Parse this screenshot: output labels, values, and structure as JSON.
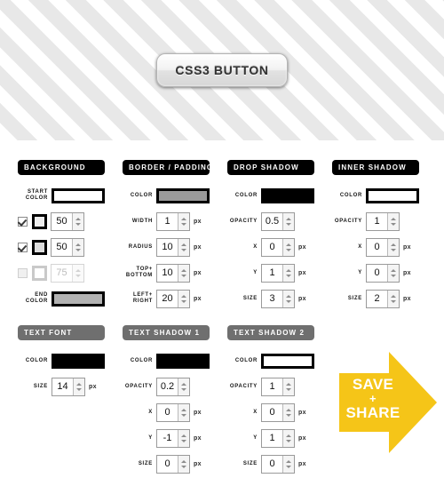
{
  "preview": {
    "button_label": "CSS3 BUTTON",
    "background_pattern": "diagonal-stripes",
    "stripe_color": "#e8e8e8",
    "base_color": "#ffffff"
  },
  "panels": {
    "background": {
      "title": "BACKGROUND",
      "header_color": "#000000",
      "start_color": {
        "label": "START COLOR",
        "value": "#ffffff"
      },
      "stops": [
        {
          "checked": true,
          "enabled": true,
          "swatch": "#eeeeee",
          "value": "50"
        },
        {
          "checked": true,
          "enabled": true,
          "swatch": "#dddddd",
          "value": "50"
        },
        {
          "checked": false,
          "enabled": false,
          "swatch": "#ffffff",
          "value": "75"
        }
      ],
      "end_color": {
        "label": "END COLOR",
        "value": "#b2b2b2"
      }
    },
    "border_padding": {
      "title": "BORDER / PADDING",
      "header_color": "#000000",
      "color": {
        "label": "COLOR",
        "value": "#9a9a9a"
      },
      "fields": [
        {
          "label": "WIDTH",
          "value": "1",
          "unit": "px"
        },
        {
          "label": "RADIUS",
          "value": "10",
          "unit": "px"
        },
        {
          "label": "TOP + BOTTOM",
          "label_line1": "TOP+",
          "label_line2": "BOTTOM",
          "value": "10",
          "unit": "px"
        },
        {
          "label": "LEFT + RIGHT",
          "label_line1": "LEFT+",
          "label_line2": "RIGHT",
          "value": "20",
          "unit": "px"
        }
      ]
    },
    "drop_shadow": {
      "title": "DROP SHADOW",
      "header_color": "#000000",
      "color": {
        "label": "COLOR",
        "value": "#000000"
      },
      "fields": [
        {
          "label": "OPACITY",
          "value": "0.5",
          "unit": ""
        },
        {
          "label": "x",
          "value": "0",
          "unit": "px"
        },
        {
          "label": "y",
          "value": "1",
          "unit": "px"
        },
        {
          "label": "SIZE",
          "value": "3",
          "unit": "px"
        }
      ]
    },
    "inner_shadow": {
      "title": "INNER SHADOW",
      "header_color": "#000000",
      "color": {
        "label": "COLOR",
        "value": "#ffffff"
      },
      "fields": [
        {
          "label": "OPACITY",
          "value": "1",
          "unit": ""
        },
        {
          "label": "x",
          "value": "0",
          "unit": "px"
        },
        {
          "label": "y",
          "value": "0",
          "unit": "px"
        },
        {
          "label": "SIZE",
          "value": "2",
          "unit": "px"
        }
      ]
    },
    "text_font": {
      "title": "TEXT FONT",
      "header_color": "#6f6f6f",
      "color": {
        "label": "COLOR",
        "value": "#000000"
      },
      "fields": [
        {
          "label": "SIZE",
          "value": "14",
          "unit": "px"
        }
      ]
    },
    "text_shadow_1": {
      "title": "TEXT SHADOW 1",
      "header_color": "#6f6f6f",
      "color": {
        "label": "COLOR",
        "value": "#000000"
      },
      "fields": [
        {
          "label": "OPACITY",
          "value": "0.2",
          "unit": ""
        },
        {
          "label": "x",
          "value": "0",
          "unit": "px"
        },
        {
          "label": "y",
          "value": "-1",
          "unit": "px"
        },
        {
          "label": "SIZE",
          "value": "0",
          "unit": "px"
        }
      ]
    },
    "text_shadow_2": {
      "title": "TEXT SHADOW 2",
      "header_color": "#6f6f6f",
      "color": {
        "label": "COLOR",
        "value": "#ffffff"
      },
      "fields": [
        {
          "label": "OPACITY",
          "value": "1",
          "unit": ""
        },
        {
          "label": "x",
          "value": "0",
          "unit": "px"
        },
        {
          "label": "y",
          "value": "1",
          "unit": "px"
        },
        {
          "label": "SIZE",
          "value": "0",
          "unit": "px"
        }
      ]
    }
  },
  "save_share": {
    "line1": "SAVE",
    "plus": "+",
    "line3": "SHARE",
    "color": "#f5c518"
  }
}
